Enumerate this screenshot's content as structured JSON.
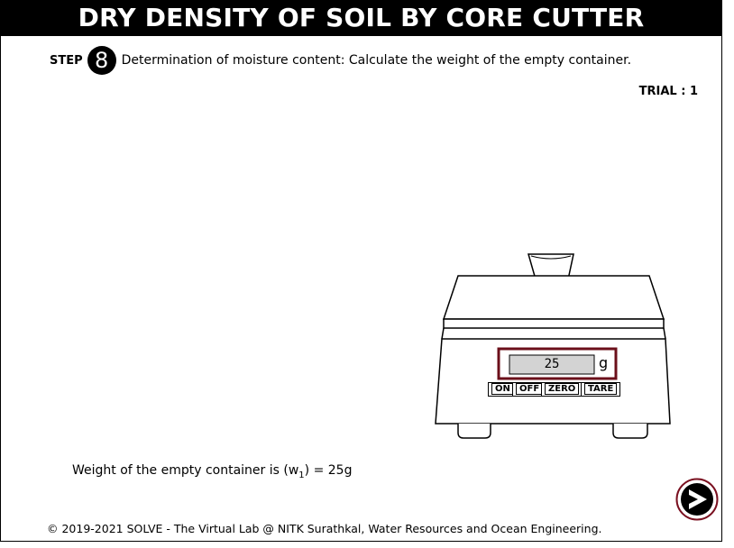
{
  "header": {
    "title": "DRY DENSITY OF SOIL BY CORE CUTTER"
  },
  "step": {
    "label": "STEP",
    "number": "8",
    "instruction": "Determination of moisture content: Calculate the weight of the empty container."
  },
  "trial": {
    "text": "TRIAL : 1"
  },
  "scale": {
    "reading": "25",
    "unit": "g",
    "buttons": {
      "on": "ON",
      "off": "OFF",
      "zero": "ZERO",
      "tare": "TARE"
    }
  },
  "result": {
    "prefix": "Weight of the empty container is (w",
    "subscript": "1",
    "suffix": ") = 25g"
  },
  "navigation": {
    "next_icon": "next-arrow-icon"
  },
  "footer": {
    "text": "© 2019-2021 SOLVE - The Virtual Lab @ NITK Surathkal, Water Resources and Ocean Engineering."
  },
  "colors": {
    "display_border": "#6b0f1a",
    "display_fill": "#d3d3d3",
    "next_ring": "#7a1020"
  }
}
